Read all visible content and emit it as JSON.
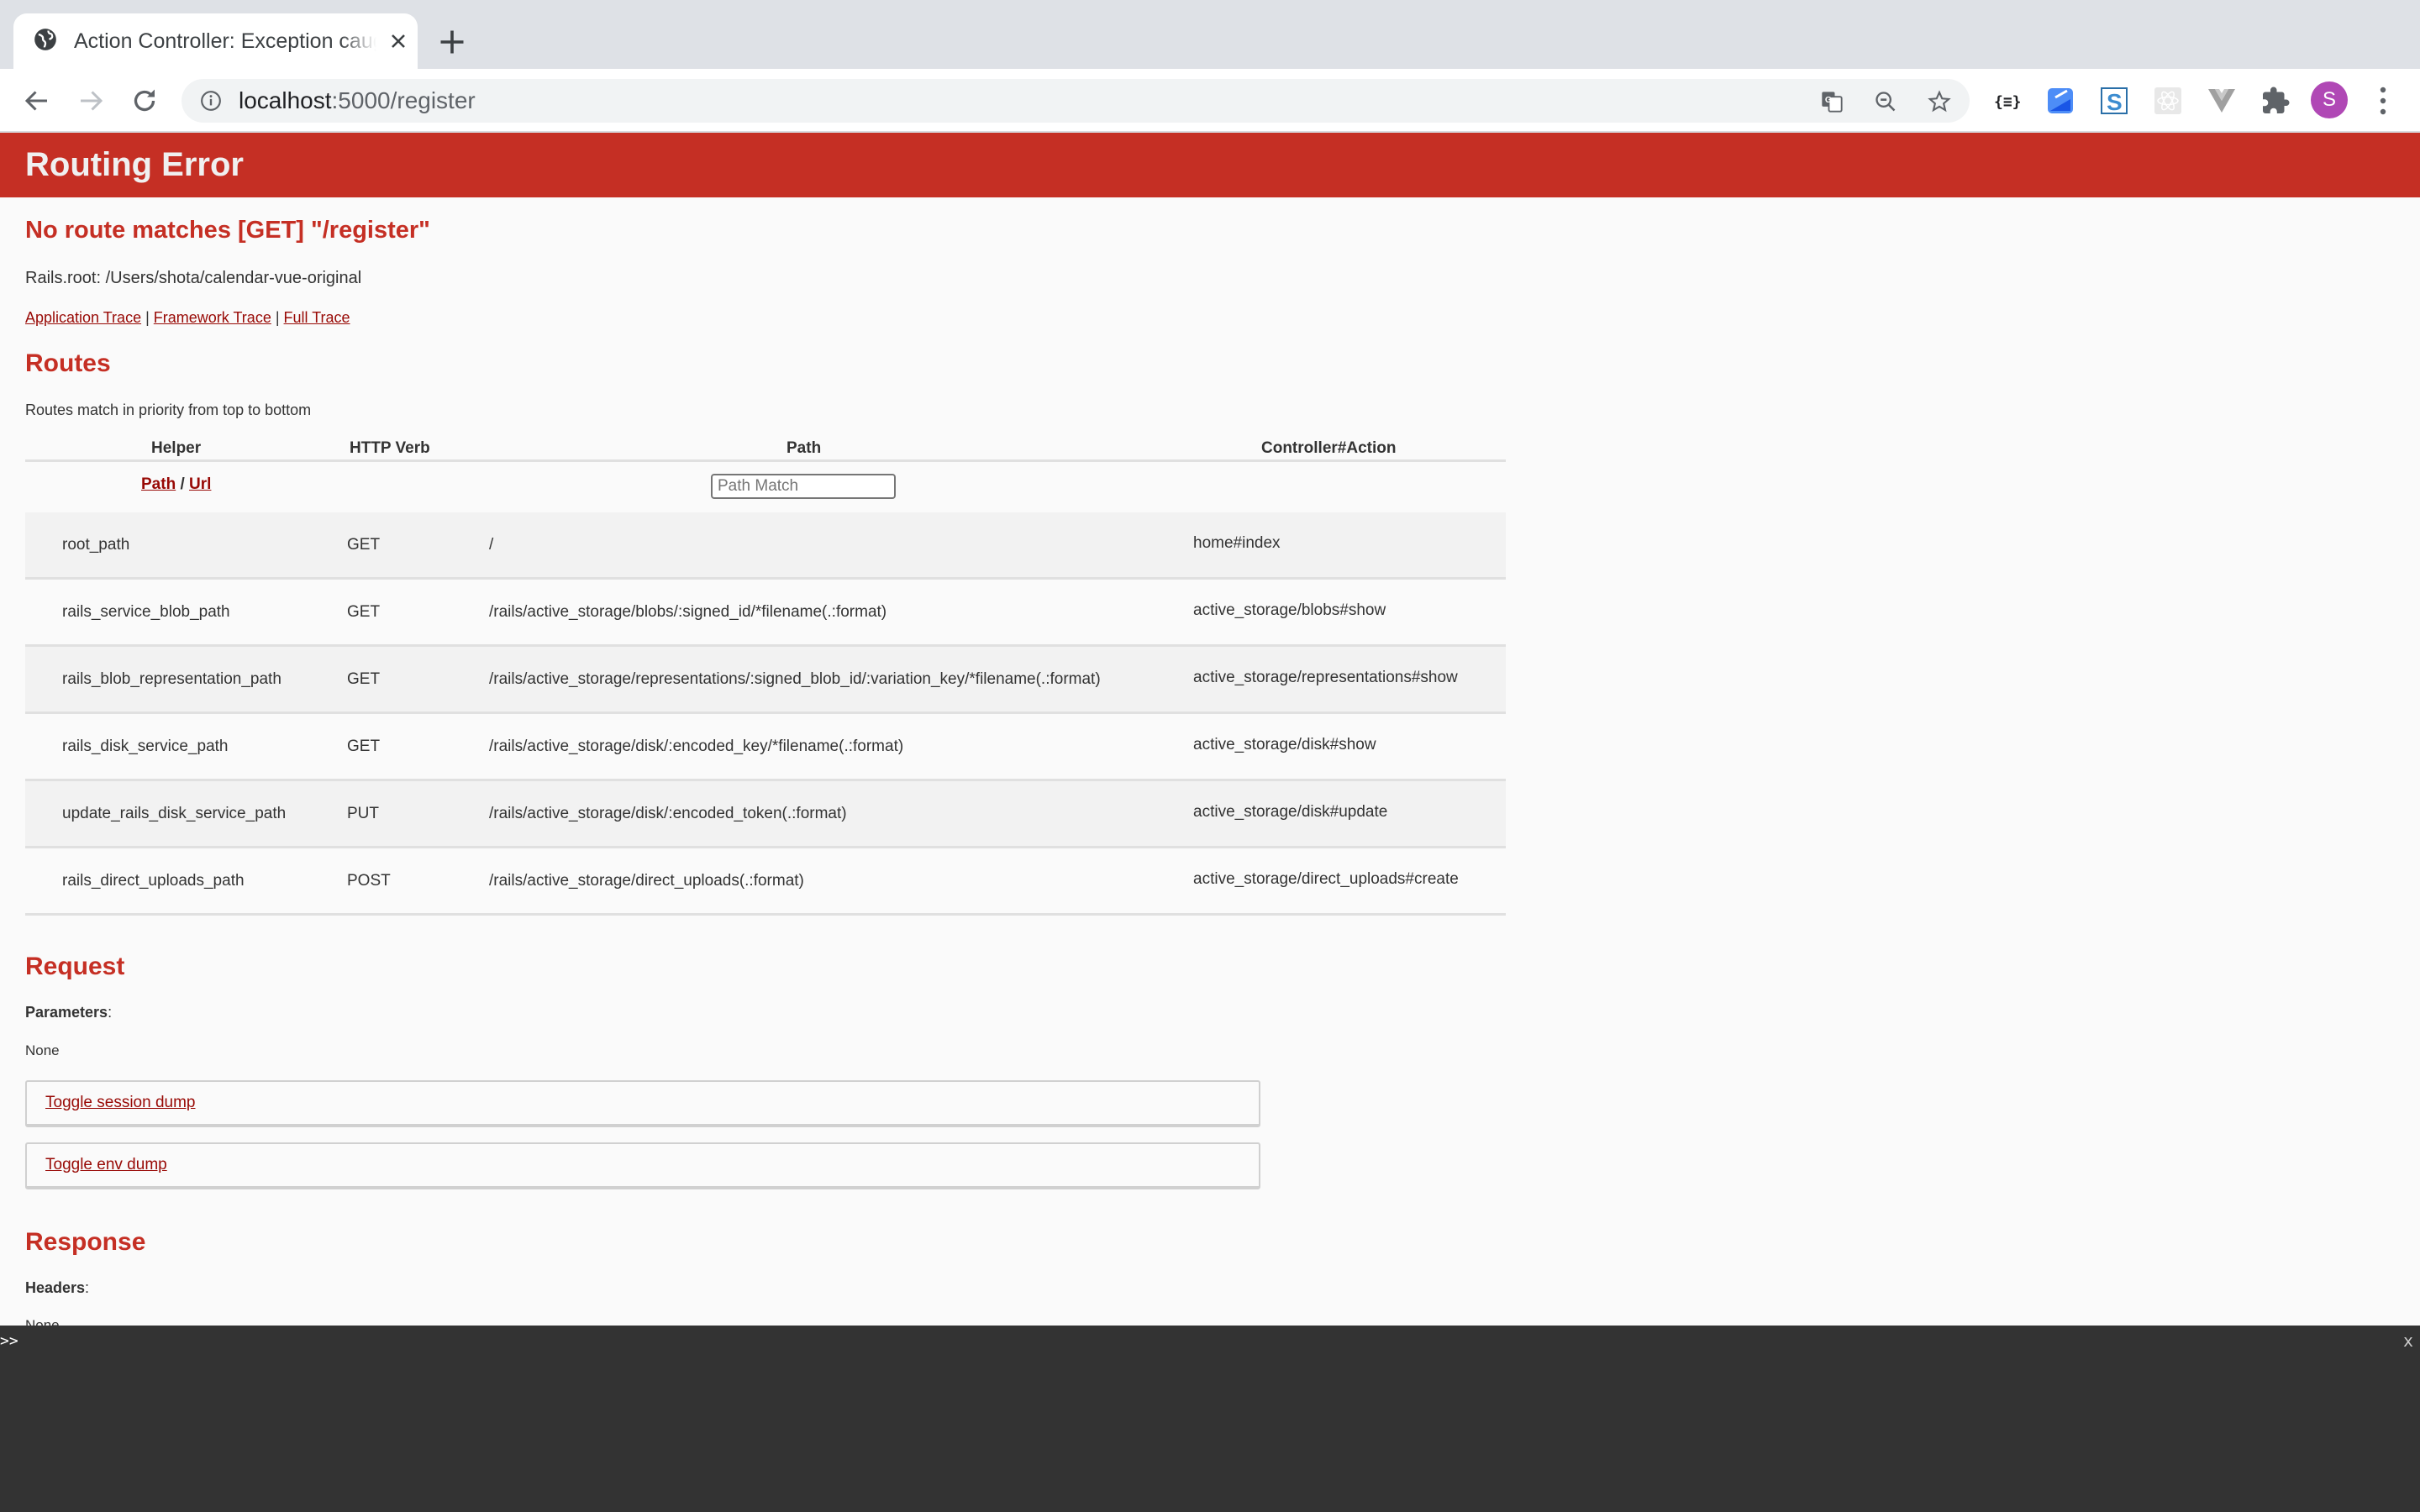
{
  "browser": {
    "tab_title": "Action Controller: Exception caught",
    "url_host": "localhost",
    "url_rest": ":5000/register",
    "avatar_letter": "S",
    "extensions": [
      "json-formatter-icon",
      "extension-blue-icon",
      "extension-s-icon",
      "react-devtools-icon",
      "vue-devtools-icon",
      "extensions-puzzle-icon"
    ]
  },
  "page": {
    "header_title": "Routing Error",
    "error_message": "No route matches [GET] \"/register\"",
    "rails_root": "Rails.root: /Users/shota/calendar-vue-original",
    "trace_links": [
      "Application Trace",
      "Framework Trace",
      "Full Trace"
    ],
    "trace_separator": "|",
    "routes": {
      "heading": "Routes",
      "description": "Routes match in priority from top to bottom",
      "columns": [
        "Helper",
        "HTTP Verb",
        "Path",
        "Controller#Action"
      ],
      "helper_toggle": {
        "path": "Path",
        "sep": "/",
        "url": "Url"
      },
      "path_filter_placeholder": "Path Match",
      "rows": [
        {
          "helper": "root_path",
          "verb": "GET",
          "path": "/",
          "action": "home#index"
        },
        {
          "helper": "rails_service_blob_path",
          "verb": "GET",
          "path": "/rails/active_storage/blobs/:signed_id/*filename(.:format)",
          "action": "active_storage/blobs#show"
        },
        {
          "helper": "rails_blob_representation_path",
          "verb": "GET",
          "path": "/rails/active_storage/representations/:signed_blob_id/:variation_key/*filename(.:format)",
          "action": "active_storage/representations#show"
        },
        {
          "helper": "rails_disk_service_path",
          "verb": "GET",
          "path": "/rails/active_storage/disk/:encoded_key/*filename(.:format)",
          "action": "active_storage/disk#show"
        },
        {
          "helper": "update_rails_disk_service_path",
          "verb": "PUT",
          "path": "/rails/active_storage/disk/:encoded_token(.:format)",
          "action": "active_storage/disk#update"
        },
        {
          "helper": "rails_direct_uploads_path",
          "verb": "POST",
          "path": "/rails/active_storage/direct_uploads(.:format)",
          "action": "active_storage/direct_uploads#create"
        }
      ]
    },
    "request": {
      "heading": "Request",
      "parameters_label": "Parameters",
      "parameters_value": "None",
      "toggle_session": "Toggle session dump",
      "toggle_env": "Toggle env dump"
    },
    "response": {
      "heading": "Response",
      "headers_label": "Headers",
      "headers_value": "None"
    }
  },
  "console": {
    "prompt": ">>",
    "close": "x"
  },
  "colors": {
    "header_red": "#c52f24",
    "link_red": "#980905",
    "console_bg": "#333333"
  }
}
